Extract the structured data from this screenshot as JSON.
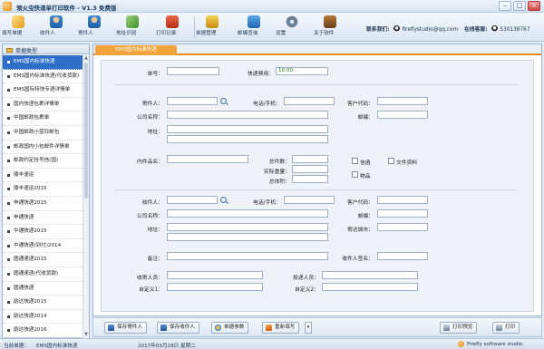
{
  "window": {
    "title": "领火虫快递单打印软件 - V1.3 免费版",
    "minimize_glyph": "–",
    "maximize_glyph": "□",
    "close_glyph": "×"
  },
  "toolbar": {
    "items": [
      {
        "label": "填写单据",
        "icon": "form-fill-icon"
      },
      {
        "label": "收件人",
        "icon": "recipient-icon"
      },
      {
        "label": "寄件人",
        "icon": "sender-icon"
      },
      {
        "label": "地址识别",
        "icon": "address-recognize-icon"
      },
      {
        "label": "打印记录",
        "icon": "print-record-icon"
      },
      {
        "label": "单据管理",
        "icon": "document-manage-icon"
      },
      {
        "label": "邮编查询",
        "icon": "postcode-query-icon"
      },
      {
        "label": "设置",
        "icon": "gear-icon"
      },
      {
        "label": "关于软件",
        "icon": "coffee-icon"
      }
    ],
    "contact_label": "联系我们:",
    "contact_email": "fireflystudio@qq.com",
    "support_label": "在线客服:",
    "support_qq": "530138767"
  },
  "sidebar": {
    "header": "单据类型",
    "items": [
      "EMS国内标准快递",
      "EMS国内标准快递(代收货款)",
      "EMS国际特快专递详情单",
      "国内快递包裹详情单",
      "中国邮政包裹单",
      "中国邮政小蓝铃邮包",
      "邮政国内小包邮件详情单",
      "邮政约定挂号信(国)",
      "顺丰速运",
      "顺丰速运2015",
      "申通快递2015",
      "申通快递",
      "中通快递2015",
      "中通快递(到付)2014",
      "圆通速递2015",
      "圆通速递(代收货款)",
      "圆通快递",
      "韵达快递2015",
      "韵达快递2014",
      "韵达快递2016"
    ],
    "active_index": 0
  },
  "tab": {
    "label": "EMS国内标准快递"
  },
  "form": {
    "order_no_label": "单号：",
    "order_no_value": "",
    "fee_label": "快递费用：",
    "fee_value": "10.00",
    "sender_label": "寄件人：",
    "sender_phone_label": "电话/手机：",
    "customer_code_label": "客户代码：",
    "company_label": "公司名称：",
    "postcode_label": "邮编：",
    "address_label": "地址：",
    "content_label": "内件品名：",
    "total_count_label": "总件数：",
    "actual_weight_label": "实际重量：",
    "total_volume_label": "总体积：",
    "doc_label": "信函",
    "file_label": "文件资料",
    "goods_label": "物品",
    "recipient_label": "收件人：",
    "recipient_phone_label": "电话/手机：",
    "recipient_customer_code_label": "客户代码：",
    "recipient_company_label": "公司名称：",
    "recipient_postcode_label": "邮编：",
    "recipient_address_label": "地址：",
    "dest_city_label": "寄达城市：",
    "note_label": "备注：",
    "recipient_sign_label": "收件人签名：",
    "courier_label": "收寄人员：",
    "delivery_label": "投递人员：",
    "custom1_label": "自定义1：",
    "custom2_label": "自定义2："
  },
  "bottombar": {
    "save_sender": "保存寄件人",
    "save_recipient": "保存收件人",
    "package_params": "单据参数",
    "refill": "重新填写",
    "dropdown_glyph": "▾",
    "print_preview": "打印预览",
    "print": "打印"
  },
  "status": {
    "current_label": "当前单据：",
    "current_value": "EMS国内标准快递",
    "date": "2017年03月28日  星期二",
    "brand": "Firefly software studio"
  }
}
